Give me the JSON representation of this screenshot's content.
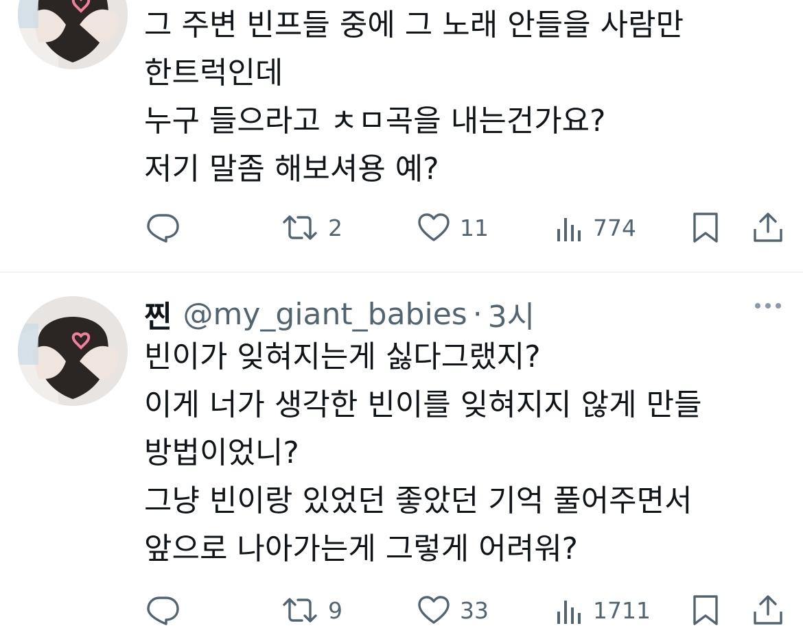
{
  "tweets": [
    {
      "lines": [
        "그 주변 빈프들 중에 그 노래 안들을 사람만",
        "한트럭인데",
        "누구 들으라고 ㅊㅁ곡을 내는건가요?",
        "저기 말좀 해보셔용 예?"
      ],
      "stats": {
        "retweets": "2",
        "likes": "11",
        "views": "774"
      }
    },
    {
      "name": "찐",
      "handle": "@my_giant_babies",
      "separator": "·",
      "time": "3시",
      "lines": [
        "빈이가 잊혀지는게 싫다그랬지?",
        "이게 너가 생각한 빈이를 잊혀지지 않게 만들",
        "방법이었니?",
        "그냥 빈이랑 있었던 좋았던 기억 풀어주면서",
        "앞으로 나아가는게 그렇게 어려워?"
      ],
      "stats": {
        "retweets": "9",
        "likes": "33",
        "views": "1711"
      }
    }
  ],
  "icons": {
    "reply": "reply-icon",
    "retweet": "retweet-icon",
    "like": "heart-icon",
    "views": "views-icon",
    "bookmark": "bookmark-icon",
    "share": "share-icon",
    "more": "more-icon"
  },
  "colors": {
    "text": "#0f1419",
    "secondary": "#536471",
    "divider": "#eff3f4"
  }
}
